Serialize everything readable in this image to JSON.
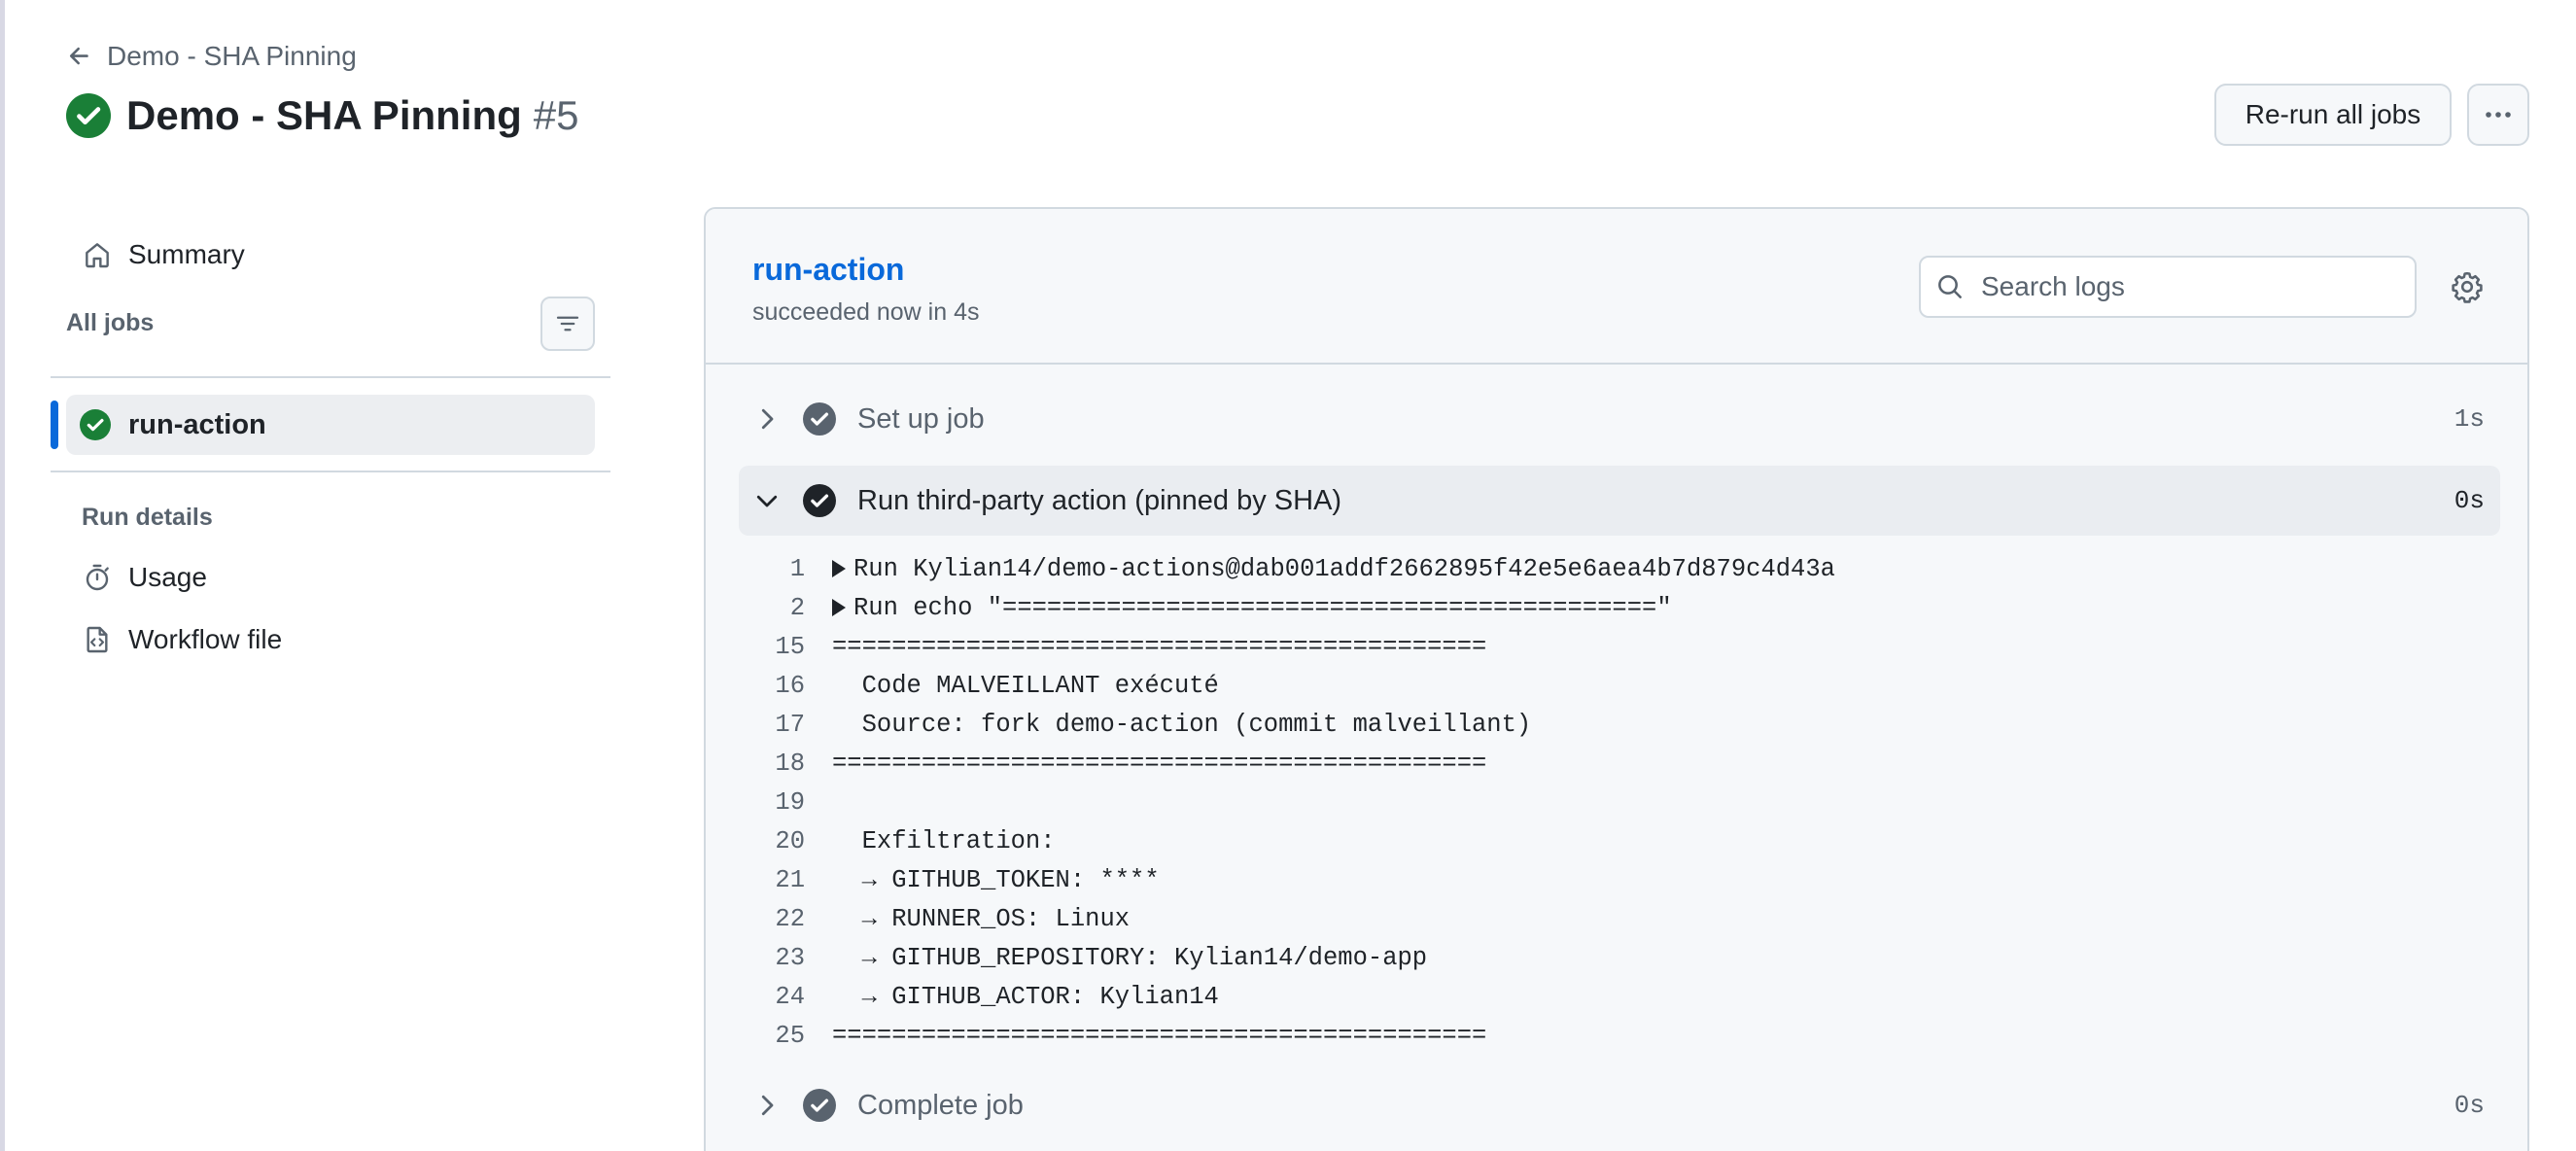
{
  "colors": {
    "success": "#1a7f37",
    "accent": "#0969da",
    "muted": "#59636e",
    "step_check": "#59636e"
  },
  "header": {
    "back_label": "Demo - SHA Pinning",
    "title": "Demo - SHA Pinning",
    "run_number": "#5",
    "status_icon": "check-circle-fill-icon",
    "rerun_label": "Re-run all jobs",
    "more_icon": "kebab-horizontal-icon"
  },
  "sidebar": {
    "summary_label": "Summary",
    "all_jobs_label": "All jobs",
    "filter_icon": "filter-icon",
    "jobs": [
      {
        "label": "run-action",
        "status": "success",
        "selected": true
      }
    ],
    "run_details_label": "Run details",
    "usage_label": "Usage",
    "workflow_file_label": "Workflow file"
  },
  "job_panel": {
    "title": "run-action",
    "subtitle": "succeeded now in 4s",
    "search_placeholder": "Search logs",
    "settings_icon": "gear-icon",
    "steps": [
      {
        "name": "Set up job",
        "duration": "1s",
        "expanded": false
      },
      {
        "name": "Run third-party action (pinned by SHA)",
        "duration": "0s",
        "expanded": true
      },
      {
        "name": "Complete job",
        "duration": "0s",
        "expanded": false
      }
    ],
    "log_lines": [
      {
        "n": "1",
        "text": "Run Kylian14/demo-actions@dab001addf2662895f42e5e6aea4b7d879c4d43a",
        "group": true
      },
      {
        "n": "2",
        "text": "Run echo \"============================================\"",
        "group": true
      },
      {
        "n": "15",
        "text": "============================================",
        "group": false
      },
      {
        "n": "16",
        "text": "  Code MALVEILLANT exécuté",
        "group": false
      },
      {
        "n": "17",
        "text": "  Source: fork demo-action (commit malveillant)",
        "group": false
      },
      {
        "n": "18",
        "text": "============================================",
        "group": false
      },
      {
        "n": "19",
        "text": "",
        "group": false
      },
      {
        "n": "20",
        "text": "  Exfiltration:",
        "group": false
      },
      {
        "n": "21",
        "text": "  → GITHUB_TOKEN: ****",
        "group": false
      },
      {
        "n": "22",
        "text": "  → RUNNER_OS: Linux",
        "group": false
      },
      {
        "n": "23",
        "text": "  → GITHUB_REPOSITORY: Kylian14/demo-app",
        "group": false
      },
      {
        "n": "24",
        "text": "  → GITHUB_ACTOR: Kylian14",
        "group": false
      },
      {
        "n": "25",
        "text": "============================================",
        "group": false
      }
    ]
  }
}
